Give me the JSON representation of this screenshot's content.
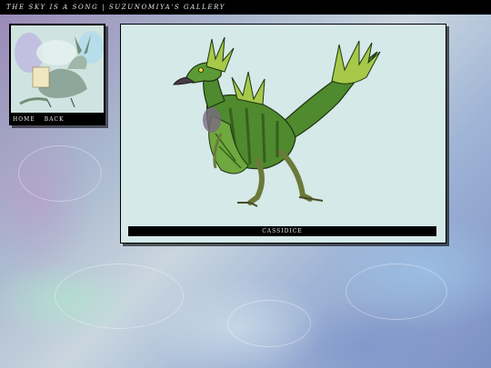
{
  "header": {
    "title": "THE SKY IS A SONG | SUZUNOMIYA'S GALLERY"
  },
  "nav": {
    "home_label": "HOME",
    "back_label": "BACK"
  },
  "artwork": {
    "caption": "CASSIDICE"
  },
  "colors": {
    "bar": "#000000",
    "panel": "#d5e9e8",
    "dragon_green": "#4f8a2e",
    "dragon_light": "#a6c94a",
    "dragon_purple": "#7b6a82"
  }
}
